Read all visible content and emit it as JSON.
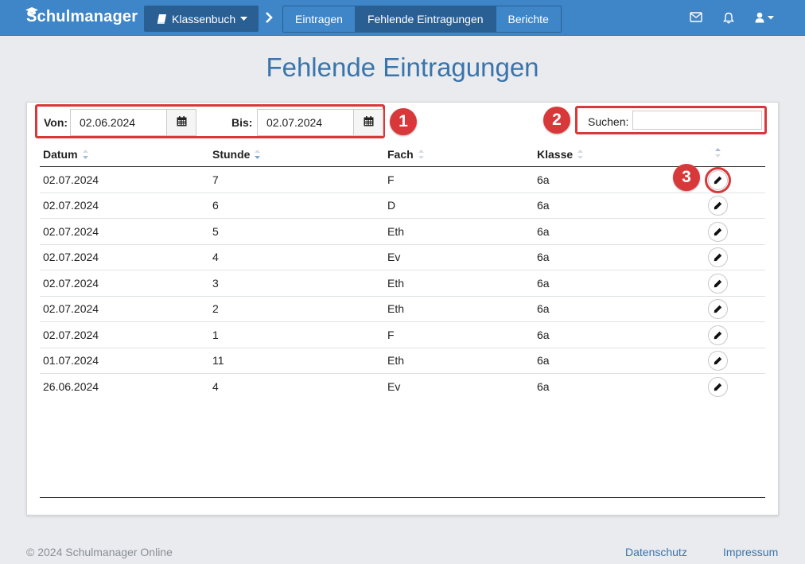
{
  "navbar": {
    "brand": "Schulmanager",
    "menu_button": "Klassenbuch",
    "tabs": [
      {
        "label": "Eintragen",
        "active": false
      },
      {
        "label": "Fehlende Eintragungen",
        "active": true
      },
      {
        "label": "Berichte",
        "active": false
      }
    ],
    "icons": [
      "graduation-cap-icon",
      "book-icon",
      "caret-down-icon",
      "chevron-right-icon",
      "envelope-icon",
      "bell-icon",
      "user-icon"
    ]
  },
  "page": {
    "title": "Fehlende Eintragungen"
  },
  "filters": {
    "from_label": "Von:",
    "from_value": "02.06.2024",
    "to_label": "Bis:",
    "to_value": "02.07.2024",
    "search_label": "Suchen:",
    "search_value": ""
  },
  "annotations": [
    "1",
    "2",
    "3"
  ],
  "table": {
    "columns": [
      "Datum",
      "Stunde",
      "Fach",
      "Klasse"
    ],
    "rows": [
      {
        "datum": "02.07.2024",
        "stunde": "7",
        "fach": "F",
        "klasse": "6a"
      },
      {
        "datum": "02.07.2024",
        "stunde": "6",
        "fach": "D",
        "klasse": "6a"
      },
      {
        "datum": "02.07.2024",
        "stunde": "5",
        "fach": "Eth",
        "klasse": "6a"
      },
      {
        "datum": "02.07.2024",
        "stunde": "4",
        "fach": "Ev",
        "klasse": "6a"
      },
      {
        "datum": "02.07.2024",
        "stunde": "3",
        "fach": "Eth",
        "klasse": "6a"
      },
      {
        "datum": "02.07.2024",
        "stunde": "2",
        "fach": "Eth",
        "klasse": "6a"
      },
      {
        "datum": "02.07.2024",
        "stunde": "1",
        "fach": "F",
        "klasse": "6a"
      },
      {
        "datum": "01.07.2024",
        "stunde": "11",
        "fach": "Eth",
        "klasse": "6a"
      },
      {
        "datum": "26.06.2024",
        "stunde": "4",
        "fach": "Ev",
        "klasse": "6a"
      }
    ]
  },
  "footer": {
    "copyright": "© 2024 Schulmanager Online",
    "links": [
      "Datenschutz",
      "Impressum"
    ]
  },
  "colors": {
    "navbar": "#3e86c8",
    "navbar_active": "#2a5f94",
    "title": "#3a74ad",
    "highlight": "#d9383a"
  }
}
